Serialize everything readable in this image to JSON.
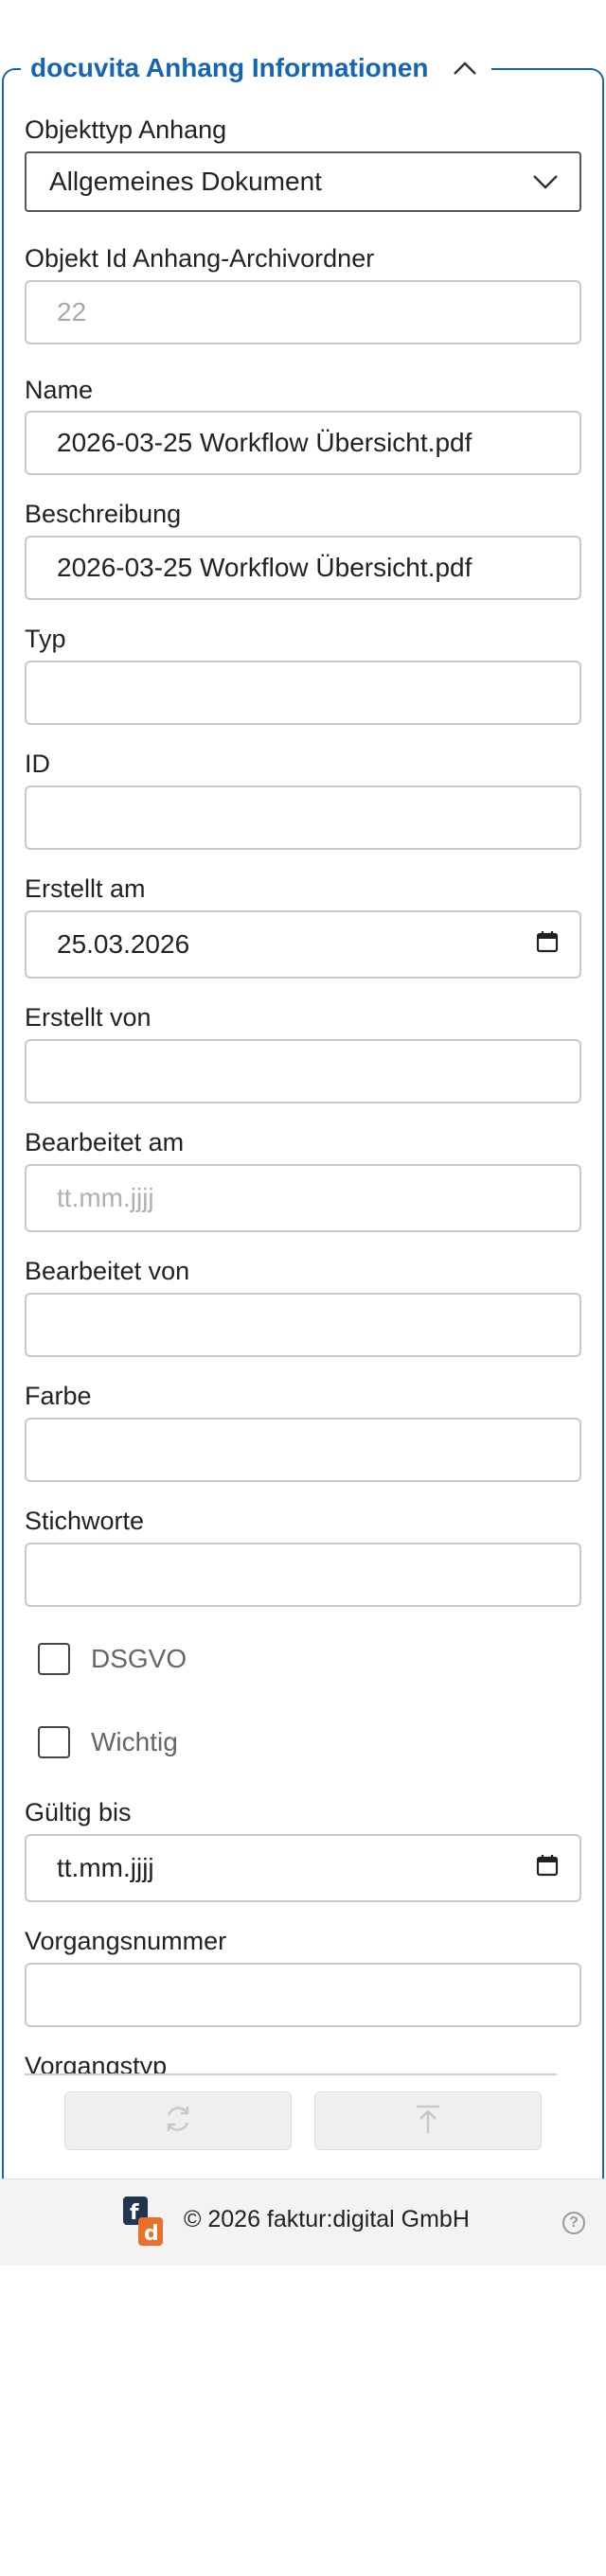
{
  "section": {
    "title": "docuvita Anhang Informationen",
    "toggle_icon": "chevron-up-icon",
    "accent_color": "#1565b5"
  },
  "fields": {
    "objekttyp": {
      "label": "Objekttyp Anhang",
      "value": "Allgemeines Dokument"
    },
    "objekt_id": {
      "label": "Objekt Id Anhang-Archivordner",
      "value": "22"
    },
    "name": {
      "label": "Name",
      "value": "2026-03-25 Workflow Übersicht.pdf"
    },
    "beschreibung": {
      "label": "Beschreibung",
      "value": "2026-03-25 Workflow Übersicht.pdf"
    },
    "typ": {
      "label": "Typ",
      "value": ""
    },
    "id": {
      "label": "ID",
      "value": ""
    },
    "erstellt_am": {
      "label": "Erstellt am",
      "value": "25.03.2026"
    },
    "erstellt_von": {
      "label": "Erstellt von",
      "value": ""
    },
    "bearbeitet_am": {
      "label": "Bearbeitet am",
      "placeholder": "tt.mm.jjjj"
    },
    "bearbeitet_von": {
      "label": "Bearbeitet von",
      "value": ""
    },
    "farbe": {
      "label": "Farbe",
      "value": ""
    },
    "stichworte": {
      "label": "Stichworte",
      "value": ""
    },
    "dsgvo": {
      "label": "DSGVO",
      "checked": false
    },
    "wichtig": {
      "label": "Wichtig",
      "checked": false
    },
    "gueltig_bis": {
      "label": "Gültig bis",
      "value": "tt.mm.jjjj"
    },
    "vorgangsnummer": {
      "label": "Vorgangsnummer",
      "value": ""
    },
    "vorgangstyp": {
      "label": "Vorgangstyp"
    }
  },
  "actions": {
    "refresh_icon": "refresh-icon",
    "upload_icon": "upload-icon"
  },
  "footer": {
    "text": "© 2026 faktur:digital GmbH",
    "logo": "faktur-digital-logo",
    "help_icon": "help-icon"
  }
}
